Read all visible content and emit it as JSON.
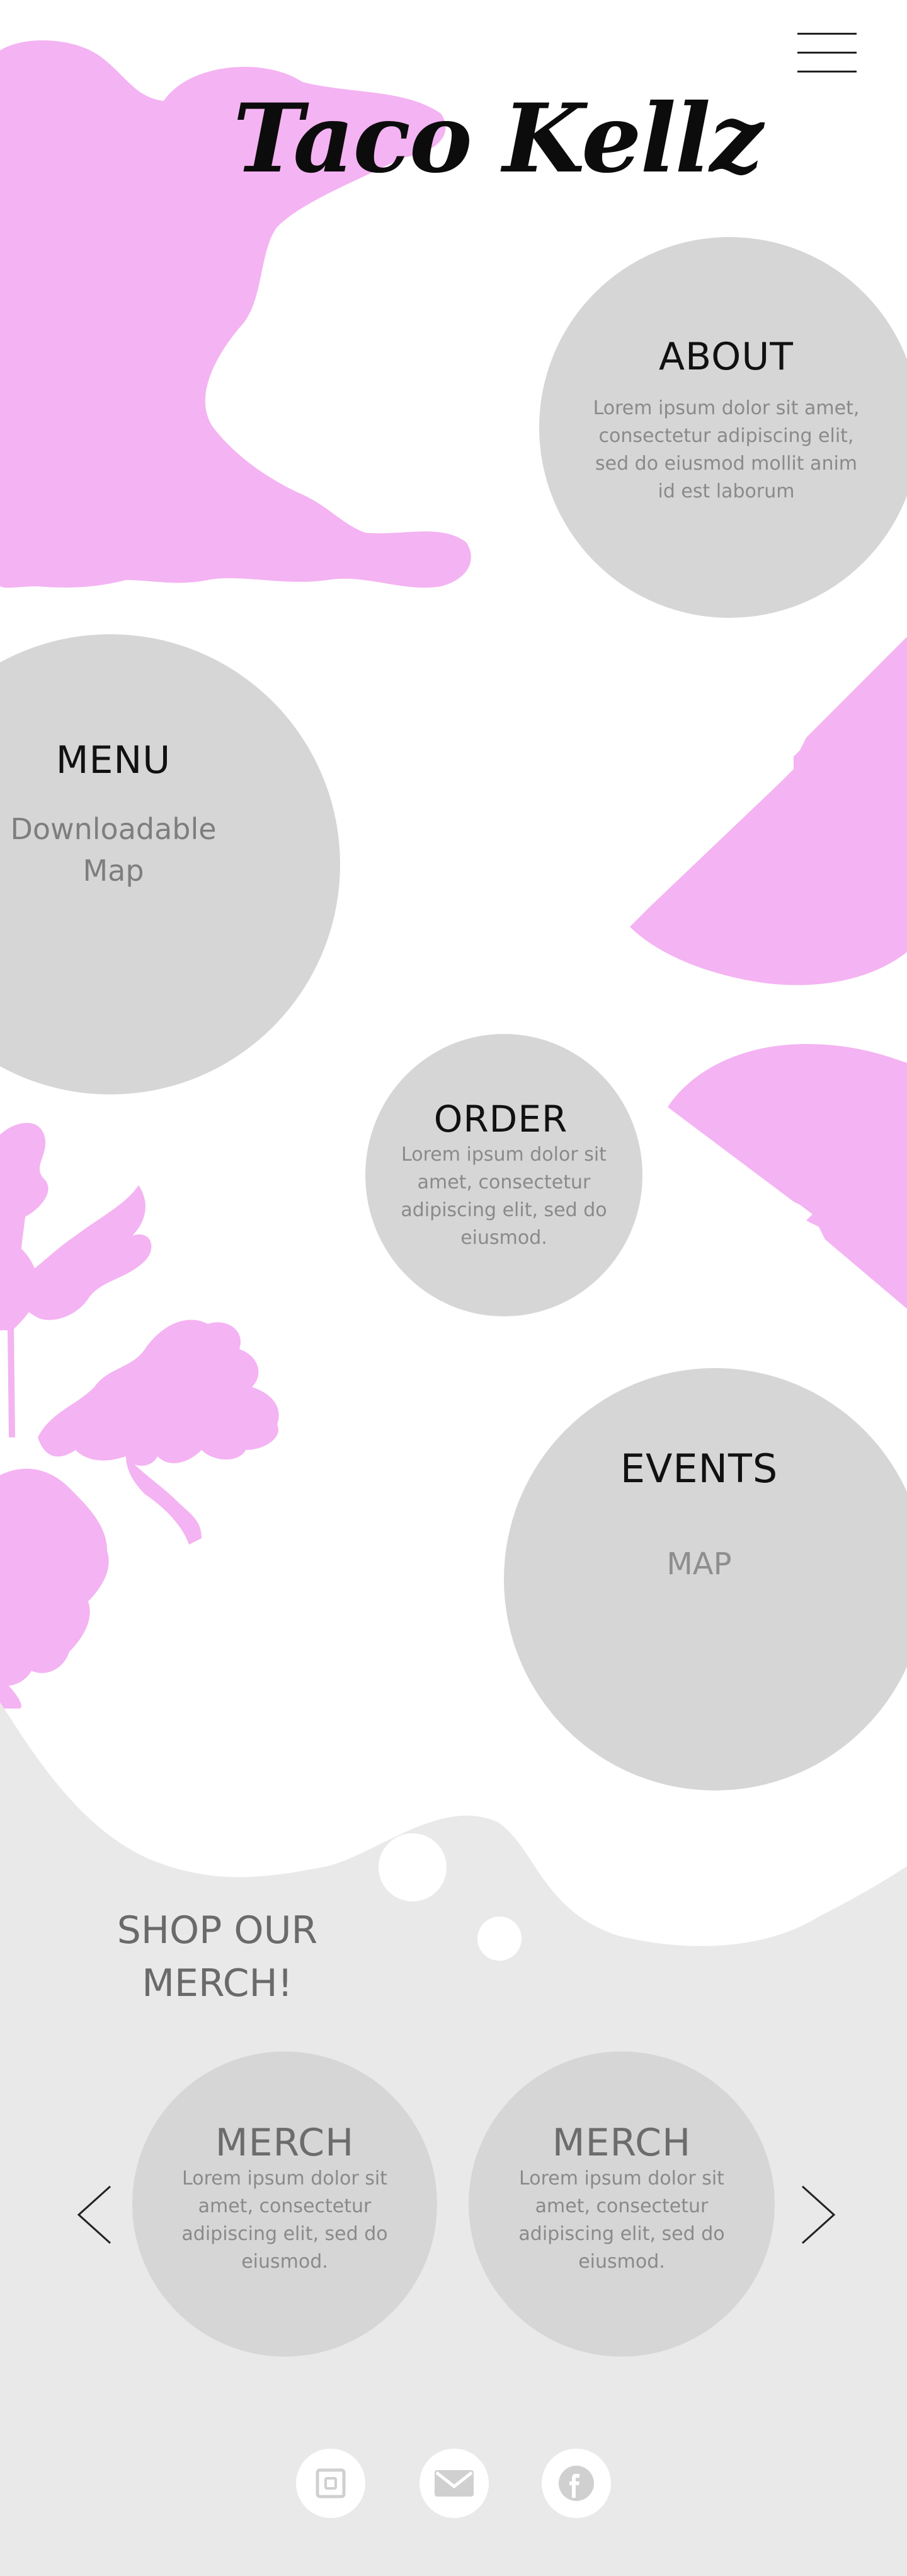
{
  "brand": {
    "logo_text": "Taco Kellz"
  },
  "nav": {
    "menu_icon": "hamburger-menu-icon"
  },
  "sections": {
    "about": {
      "title": "ABOUT",
      "body": "Lorem ipsum dolor sit amet, consectetur adipiscing elit, sed do eiusmod mollit anim id est laborum"
    },
    "menu": {
      "title": "MENU",
      "body": "Downloadable Map"
    },
    "order": {
      "title": "ORDER",
      "body": "Lorem ipsum dolor sit amet, consectetur adipiscing elit, sed do eiusmod."
    },
    "events": {
      "title": "EVENTS",
      "body": "MAP"
    }
  },
  "shop": {
    "title": "SHOP OUR MERCH!",
    "items": [
      {
        "title": "MERCH",
        "body": "Lorem ipsum dolor sit amet, consectetur adipiscing elit, sed do eiusmod."
      },
      {
        "title": "MERCH",
        "body": "Lorem ipsum dolor sit amet, consectetur adipiscing elit, sed do eiusmod."
      }
    ],
    "prev_icon": "chevron-left-icon",
    "next_icon": "chevron-right-icon"
  },
  "footer": {
    "social": [
      "instagram-icon",
      "mail-icon",
      "facebook-icon"
    ]
  },
  "colors": {
    "accent_pink": "#f4b3f2",
    "circle_gray": "#d6d6d6",
    "footer_gray": "#e9e9e9",
    "title_black": "#111111",
    "body_gray": "#8a8a8a"
  }
}
